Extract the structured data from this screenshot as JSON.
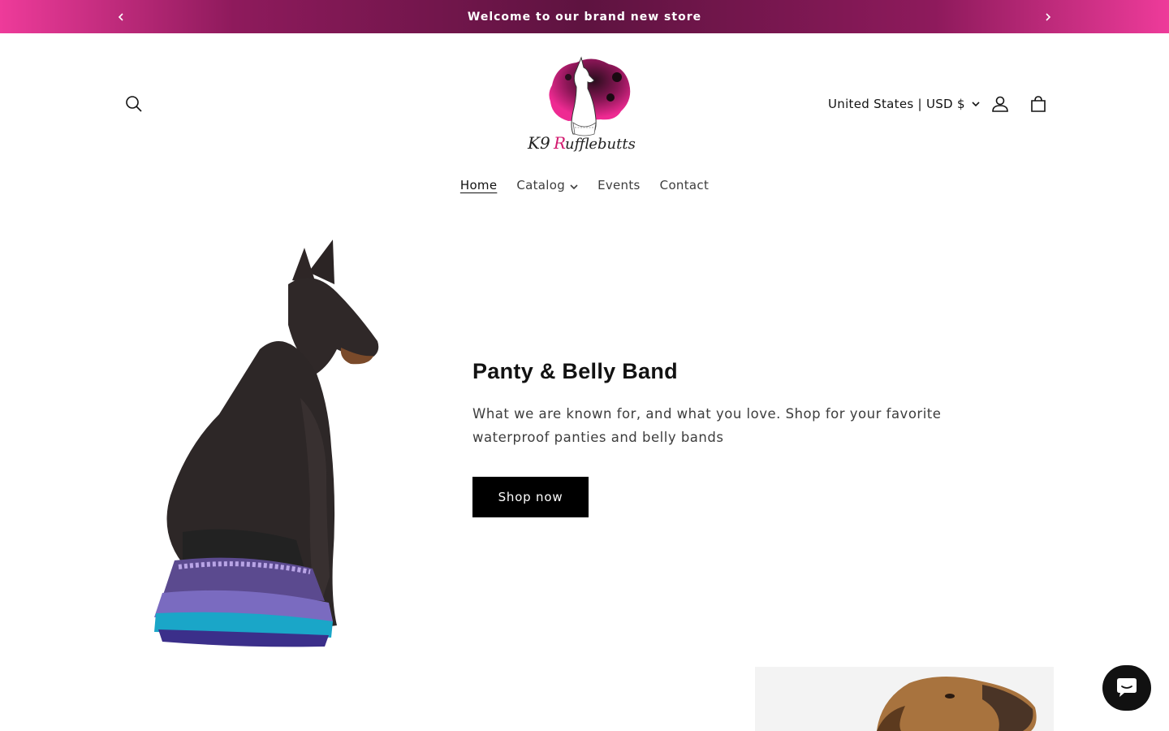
{
  "announcement": {
    "text": "Welcome to our brand new store",
    "prev_icon": "chevron-left-icon",
    "next_icon": "chevron-right-icon"
  },
  "header": {
    "logo_text": "K9 Rufflebutts",
    "locale_label": "United States | USD $",
    "icons": [
      "search-icon",
      "account-icon",
      "cart-icon"
    ]
  },
  "nav": {
    "items": [
      {
        "label": "Home",
        "active": true
      },
      {
        "label": "Catalog",
        "has_dropdown": true
      },
      {
        "label": "Events"
      },
      {
        "label": "Contact"
      }
    ]
  },
  "hero": {
    "title": "Panty & Belly Band",
    "description": "What we are known for, and what you love. Shop for your favorite waterproof panties and belly bands",
    "button_label": "Shop now"
  },
  "colors": {
    "announcement_gradient": [
      "#ee3b9a",
      "#5e1340"
    ],
    "button_bg": "#000000",
    "logo_pink": "#e0157f"
  },
  "chat": {
    "icon": "chat-icon"
  }
}
